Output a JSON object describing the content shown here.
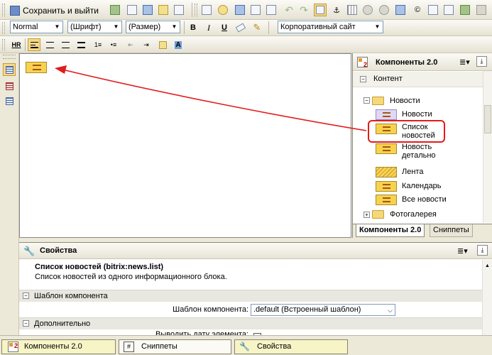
{
  "toolbar1": {
    "save_exit_label": "Сохранить и выйти"
  },
  "toolbar2": {
    "style_select": "Normal",
    "font_select": "(Шрифт)",
    "size_select": "(Размер)",
    "bold": "B",
    "italic": "I",
    "underline": "U",
    "template_select": "Корпоративный сайт"
  },
  "toolbar3": {
    "hr": "HR"
  },
  "components_panel": {
    "title": "Компоненты 2.0",
    "section": "Контент",
    "folder_news": "Новости",
    "items": [
      {
        "label": "Новости"
      },
      {
        "label1": "Список",
        "label2": "новостей"
      },
      {
        "label1": "Новость",
        "label2": "детально"
      },
      {
        "label": "Лента"
      },
      {
        "label": "Календарь"
      },
      {
        "label": "Все новости"
      }
    ],
    "folder_photo": "Фотогалерея",
    "tab_components": "Компоненты 2.0",
    "tab_snippets": "Сниппеты"
  },
  "properties_panel": {
    "title": "Свойства",
    "component_name": "Список новостей (bitrix:news.list)",
    "component_desc": "Список новостей из одного информационного блока.",
    "section_template": "Шаблон компонента",
    "field_template_label": "Шаблон компонента:",
    "field_template_value": ".default (Встроенный шаблон)",
    "section_extra": "Дополнительно",
    "field_show_date_label": "Выводить дату элемента:"
  },
  "taskbar": {
    "tab1": "Компоненты 2.0",
    "tab2": "Сниппеты",
    "tab3": "Свойства"
  },
  "colors": {
    "highlight_red": "#e21b1b",
    "component_yellow": "#f8d24f",
    "window_bg": "#ece9d8"
  }
}
